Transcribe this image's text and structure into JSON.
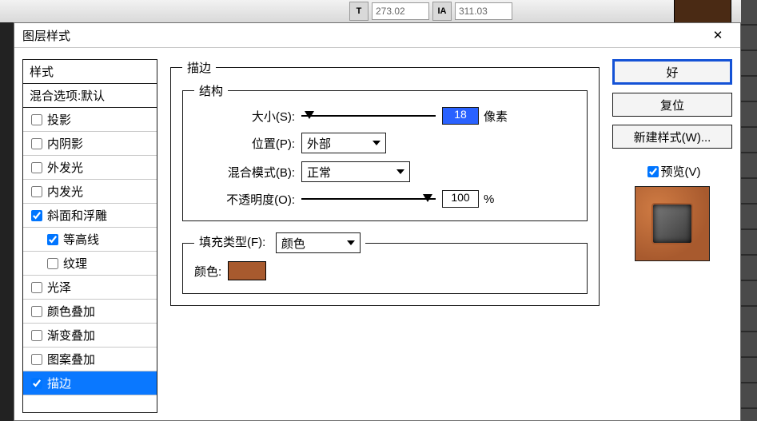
{
  "toolbar": {
    "field1": "273.02",
    "field2": "311.03"
  },
  "dialog": {
    "title": "图层样式",
    "close": "✕"
  },
  "styles": {
    "header": "样式",
    "blending": "混合选项:默认",
    "items": [
      {
        "label": "投影",
        "checked": false
      },
      {
        "label": "内阴影",
        "checked": false
      },
      {
        "label": "外发光",
        "checked": false
      },
      {
        "label": "内发光",
        "checked": false
      },
      {
        "label": "斜面和浮雕",
        "checked": true
      },
      {
        "label": "等高线",
        "checked": true,
        "indent": true
      },
      {
        "label": "纹理",
        "checked": false,
        "indent": true
      },
      {
        "label": "光泽",
        "checked": false
      },
      {
        "label": "颜色叠加",
        "checked": false
      },
      {
        "label": "渐变叠加",
        "checked": false
      },
      {
        "label": "图案叠加",
        "checked": false
      },
      {
        "label": "描边",
        "checked": true,
        "selected": true
      }
    ]
  },
  "stroke": {
    "legend": "描边",
    "struct_legend": "结构",
    "size_label": "大小(S):",
    "size_value": "18",
    "size_unit": "像素",
    "position_label": "位置(P):",
    "position_value": "外部",
    "blend_label": "混合模式(B):",
    "blend_value": "正常",
    "opacity_label": "不透明度(O):",
    "opacity_value": "100",
    "opacity_unit": "%",
    "filltype_label": "填充类型(F):",
    "filltype_value": "颜色",
    "color_label": "颜色:",
    "color_value": "#a85a2e"
  },
  "buttons": {
    "ok": "好",
    "reset": "复位",
    "newstyle": "新建样式(W)...",
    "preview": "预览(V)"
  }
}
